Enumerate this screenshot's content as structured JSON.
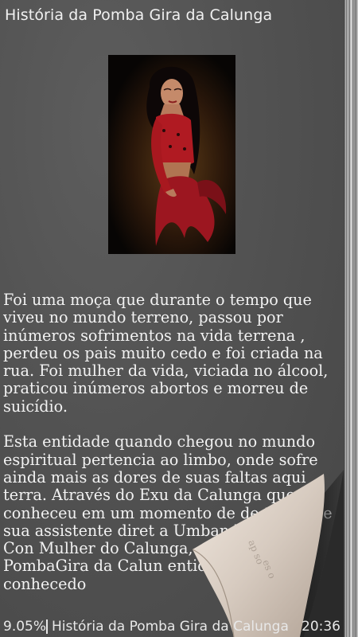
{
  "reader": {
    "book_title": "História da Pomba Gira da Calunga",
    "paragraphs": [
      "Foi uma moça que durante o tempo que viveu no mundo terreno, passou por inúmeros sofrimentos na vida terrena , perdeu os pais muito cedo e foi criada na rua. Foi mulher da vida, viciada no álcool, praticou inúmeros abortos e morreu de suicídio.",
      "Esta entidade quando chegou no mundo espiritual pertencia ao limbo, onde sofre ainda mais as dores de suas faltas aqui terra. Através do Exu da Calunga que conheceu em um momento de de tornouse sua assistente diret a Umbanda onde foi Con Mulher do Calunga, que l como PombaGira da Calun entidade de fé e conhecedo"
    ]
  },
  "status_bar": {
    "progress": "9.05%",
    "chapter": "História da Pomba Gira da Calunga",
    "clock": "20:36"
  },
  "colors": {
    "page_background": "#525252",
    "text": "#f2f2f2",
    "curl_paper": "#d8cfc6"
  },
  "icons": {
    "page_curl": "page-curl-icon"
  }
}
